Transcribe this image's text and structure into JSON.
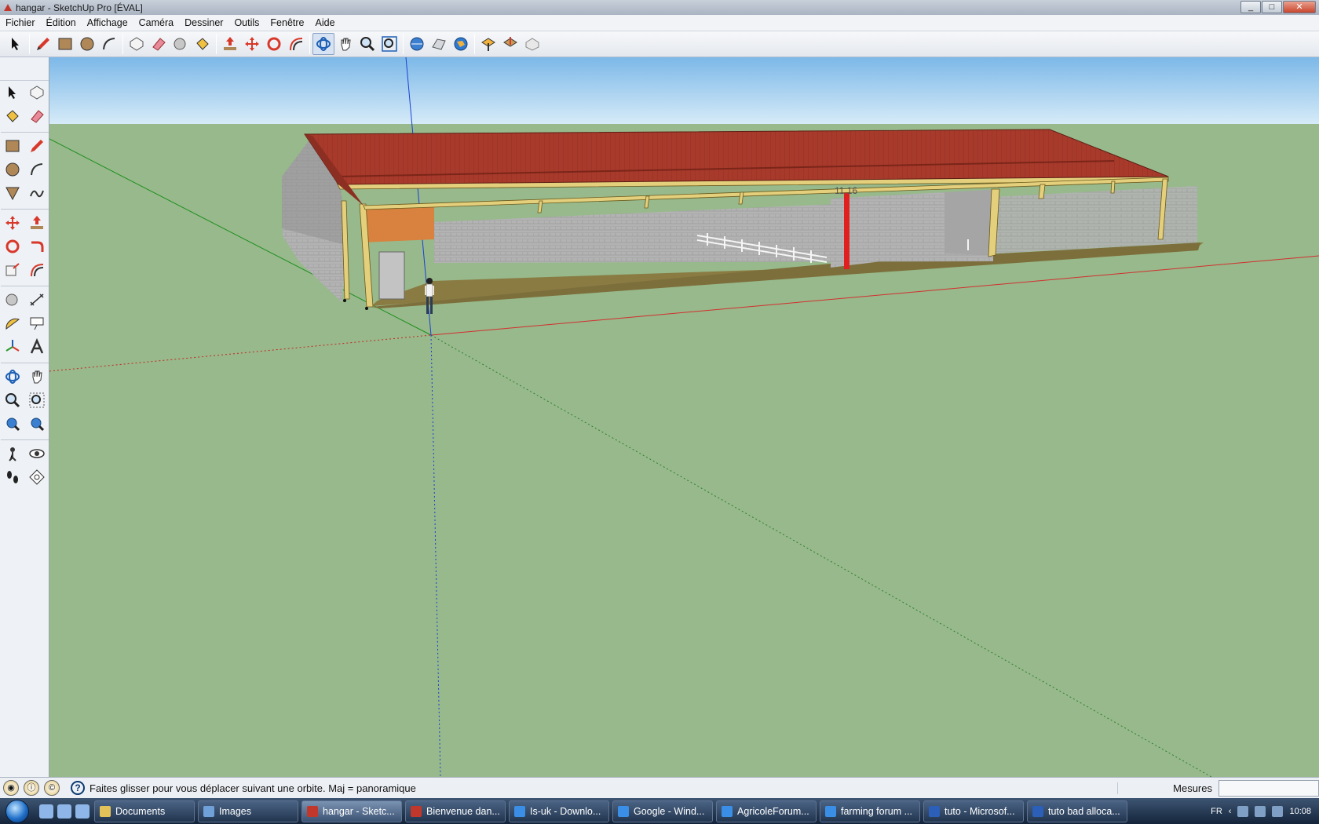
{
  "window": {
    "title": "hangar - SketchUp Pro [ÉVAL]",
    "minimize": "_",
    "maximize": "□",
    "close": "✕"
  },
  "menu": [
    "Fichier",
    "Édition",
    "Affichage",
    "Caméra",
    "Dessiner",
    "Outils",
    "Fenêtre",
    "Aide"
  ],
  "toolbar": [
    "select-icon",
    "pencil-icon",
    "rectangle-icon",
    "circle-icon",
    "arc-icon",
    "make-component-icon",
    "eraser-icon",
    "tape-measure-icon",
    "paint-bucket-icon",
    "push-pull-icon",
    "move-icon",
    "rotate-icon",
    "offset-icon",
    "orbit-icon",
    "pan-icon",
    "zoom-icon",
    "zoom-extents-icon",
    "get-models-icon",
    "share-model-icon",
    "google-earth-icon",
    "get-current-view-icon",
    "toggle-terrain-icon",
    "place-model-icon"
  ],
  "left_tools": [
    "select-icon",
    "make-component-icon",
    "paint-bucket-icon",
    "eraser-icon",
    "rectangle-icon",
    "line-icon",
    "circle-icon",
    "arc-icon",
    "polygon-icon",
    "freehand-icon",
    "move-icon",
    "push-pull-icon",
    "rotate-icon",
    "follow-me-icon",
    "scale-icon",
    "offset-icon",
    "tape-measure-icon",
    "dimension-icon",
    "protractor-icon",
    "text-icon",
    "axes-icon",
    "3d-text-icon",
    "orbit-icon",
    "pan-icon",
    "zoom-icon",
    "zoom-window-icon",
    "previous-view-icon",
    "next-view-icon",
    "position-camera-icon",
    "look-around-icon",
    "walk-icon",
    "section-plane-icon"
  ],
  "viewport": {
    "dimension_label": "11,16",
    "sky_color": "#a9d0f1",
    "ground_color": "#97b98b",
    "roof_color": "#a83a2c"
  },
  "status": {
    "message": "Faites glisser pour vous déplacer suivant une orbite.  Maj = panoramique",
    "measures_label": "Mesures",
    "measures_value": ""
  },
  "taskbar": {
    "tasks": [
      {
        "label": "Documents",
        "color": "#e3c25a"
      },
      {
        "label": "Images",
        "color": "#6fa0d8"
      },
      {
        "label": "hangar - Sketc...",
        "color": "#c2372b",
        "active": true
      },
      {
        "label": "Bienvenue dan...",
        "color": "#c2372b"
      },
      {
        "label": "Is-uk - Downlo...",
        "color": "#3a8ee6"
      },
      {
        "label": "Google - Wind...",
        "color": "#3a8ee6"
      },
      {
        "label": "AgricoleForum...",
        "color": "#3a8ee6"
      },
      {
        "label": "farming forum ...",
        "color": "#3a8ee6"
      },
      {
        "label": "tuto - Microsof...",
        "color": "#2b5fb8"
      },
      {
        "label": "tuto bad alloca...",
        "color": "#2b5fb8"
      }
    ],
    "language": "FR",
    "clock": "10:08"
  }
}
